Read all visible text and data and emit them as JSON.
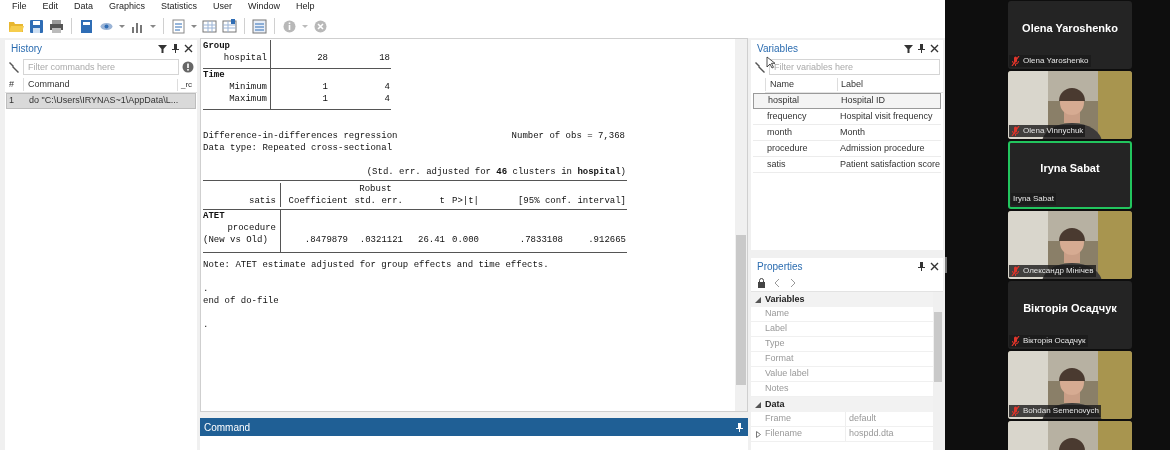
{
  "menu": [
    "File",
    "Edit",
    "Data",
    "Graphics",
    "Statistics",
    "User",
    "Window",
    "Help"
  ],
  "history": {
    "title": "History",
    "filter_placeholder": "Filter commands here",
    "columns": [
      "#",
      "Command",
      "_rc"
    ],
    "rows": [
      {
        "number": "1",
        "command": "do \"C:\\Users\\IRYNAS~1\\AppData\\L...",
        "selected": true
      }
    ]
  },
  "results": {
    "group_table": [
      {
        "heading": "Group",
        "rows": [
          {
            "label": "hospital",
            "values": [
              "28",
              "18"
            ]
          }
        ]
      },
      {
        "heading": "Time",
        "rows": [
          {
            "label": "Minimum",
            "values": [
              "1",
              "4"
            ]
          },
          {
            "label": "Maximum",
            "values": [
              "1",
              "4"
            ]
          }
        ]
      }
    ],
    "regression_title": "Difference-in-differences regression",
    "obs": "Number of obs = 7,368",
    "data_type": "Data type: Repeated cross-sectional",
    "se_note": "(Std. err. adjusted for **46** clusters in **hospital**)",
    "coef_table": {
      "depvar": "satis",
      "robust": "Robust",
      "columns": [
        "Coefficient",
        "std. err.",
        "t",
        "P>|t|",
        "[95% conf. interval]"
      ],
      "section": "ATET",
      "row_lines": [
        "procedure",
        "(New vs Old)"
      ],
      "values": [
        ".8479879",
        ".0321121",
        "26.41",
        "0.000",
        ".7833108",
        ".912665"
      ]
    },
    "note": "Note: ATET estimate adjusted for group effects and time effects.",
    "trailing": [
      ".",
      "end of do-file",
      "."
    ]
  },
  "command": {
    "title": "Command"
  },
  "variables": {
    "title": "Variables",
    "filter_placeholder": "Filter variables here",
    "columns": [
      "Name",
      "Label"
    ],
    "rows": [
      {
        "name": "hospital",
        "label": "Hospital ID",
        "selected": true
      },
      {
        "name": "frequency",
        "label": "Hospital visit frequency",
        "selected": false
      },
      {
        "name": "month",
        "label": "Month",
        "selected": false
      },
      {
        "name": "procedure",
        "label": "Admission procedure",
        "selected": false
      },
      {
        "name": "satis",
        "label": "Patient satisfaction score",
        "selected": false
      }
    ]
  },
  "properties": {
    "title": "Properties",
    "sections": [
      {
        "title": "Variables",
        "expanded": true,
        "rows": [
          {
            "key": "Name"
          },
          {
            "key": "Label"
          },
          {
            "key": "Type"
          },
          {
            "key": "Format"
          },
          {
            "key": "Value label"
          },
          {
            "key": "Notes"
          }
        ]
      },
      {
        "title": "Data",
        "expanded": true,
        "rows": [
          {
            "key": "Frame",
            "value": "default"
          },
          {
            "key": "Filename",
            "value": "hospdd.dta",
            "expandable": true
          }
        ]
      }
    ]
  },
  "participants": [
    {
      "kind": "name",
      "name": "Olena Yaroshenko",
      "label": "Olena Yaroshenko",
      "muted": true,
      "active": false
    },
    {
      "kind": "video",
      "label": "Olena Vinnychuk",
      "muted": true,
      "active": false
    },
    {
      "kind": "name",
      "name": "Iryna Sabat",
      "label": "Iryna Sabat",
      "muted": false,
      "active": true
    },
    {
      "kind": "video",
      "label": "Олександр Мінічев",
      "muted": true,
      "active": false
    },
    {
      "kind": "name",
      "name": "Вікторія Осадчук",
      "label": "Вікторія Осадчук",
      "muted": true,
      "active": false
    },
    {
      "kind": "video",
      "label": "Bohdan Semenovych",
      "muted": true,
      "active": false
    },
    {
      "kind": "video",
      "muted": false,
      "active": false
    }
  ]
}
